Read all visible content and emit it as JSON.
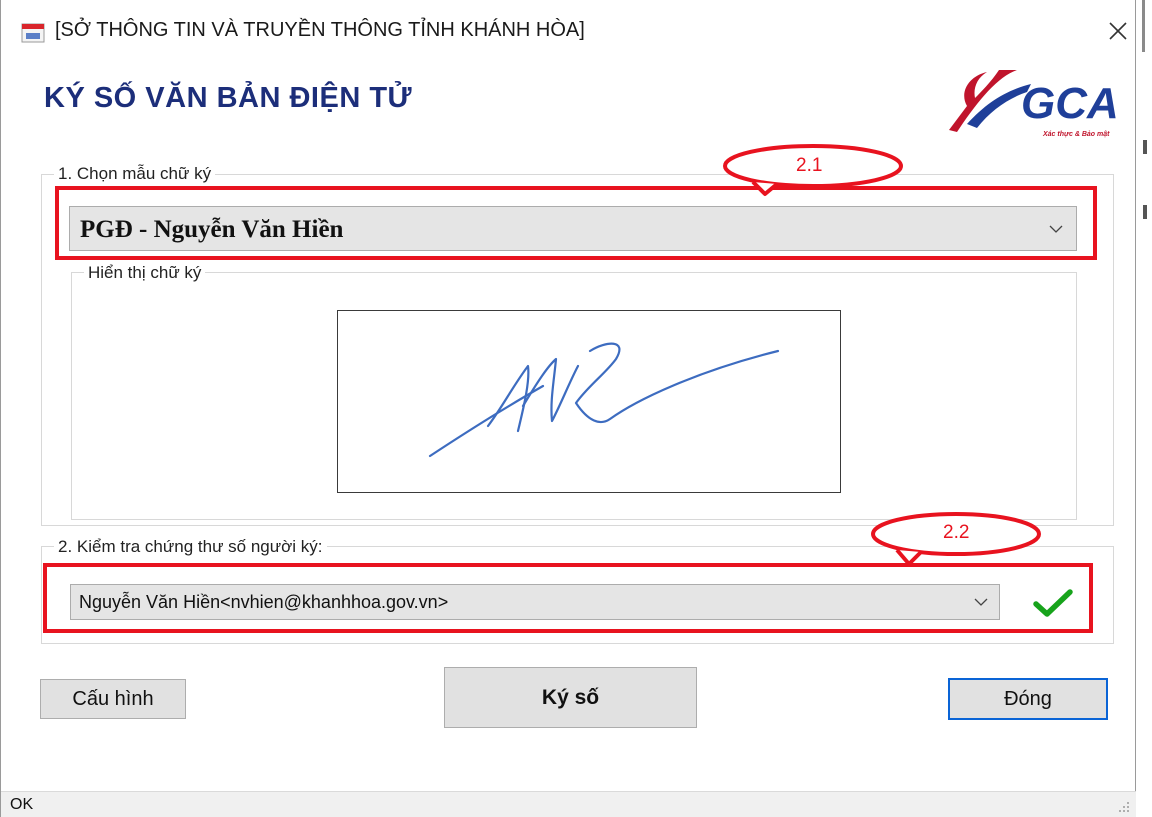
{
  "window": {
    "title": "[SỞ THÔNG TIN VÀ TRUYỀN THÔNG TỈNH KHÁNH HÒA]",
    "heading": "KÝ SỐ VĂN BẢN ĐIỆN TỬ",
    "logo_text": "GCA",
    "logo_tagline": "Xác thực & Bảo mật"
  },
  "section1": {
    "legend": "1. Chọn mẫu chữ ký",
    "selected_template": "PGĐ - Nguyễn Văn Hiền",
    "preview_legend": "Hiển thị chữ ký"
  },
  "section2": {
    "legend": "2. Kiểm tra chứng thư số người ký:",
    "selected_certificate": "Nguyễn Văn Hiền<nvhien@khanhhoa.gov.vn>"
  },
  "annotations": {
    "callout_1": "2.1",
    "callout_2": "2.2"
  },
  "buttons": {
    "config": "Cấu hình",
    "sign": "Ký số",
    "close": "Đóng"
  },
  "status": {
    "text": "OK"
  },
  "colors": {
    "heading": "#1c2e7a",
    "annotation_red": "#e8131f",
    "check_green": "#17a31b",
    "focus_blue": "#0a64d6"
  }
}
